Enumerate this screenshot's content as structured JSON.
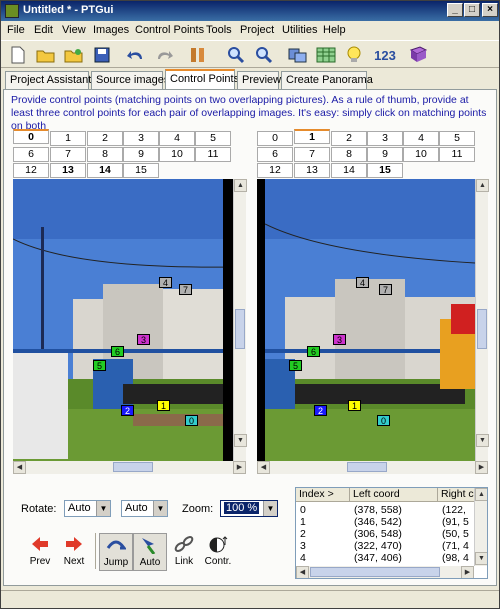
{
  "window": {
    "title": "Untitled * - PTGui"
  },
  "menu": [
    "File",
    "Edit",
    "View",
    "Images",
    "Control Points",
    "Tools",
    "Project",
    "Utilities",
    "Help"
  ],
  "toolbar": {
    "icons": [
      "new-icon",
      "open-icon",
      "open-recent-icon",
      "save-icon",
      "undo-icon",
      "redo-icon",
      "tools-icon",
      "zoom-in-icon",
      "zoom-out-icon",
      "panorama-editor-icon",
      "table-icon",
      "tips-icon",
      "numbers-icon",
      "help-book-icon"
    ],
    "numbers_label": "123"
  },
  "tabs": [
    "Project Assistant",
    "Source images",
    "Control Points",
    "Preview",
    "Create Panorama"
  ],
  "active_tab": 2,
  "instructions": "Provide control points (matching points on two overlapping pictures). As a rule of thumb, provide at least three control points for each pair of overlapping images. It's easy: simply click on matching points on both",
  "left_image_tabs": [
    "0",
    "1",
    "2",
    "3",
    "4",
    "5",
    "6",
    "7",
    "8",
    "9",
    "10",
    "11",
    "12",
    "13",
    "14",
    "15"
  ],
  "right_image_tabs": [
    "0",
    "1",
    "2",
    "3",
    "4",
    "5",
    "6",
    "7",
    "8",
    "9",
    "10",
    "11",
    "12",
    "13",
    "14",
    "15"
  ],
  "control_points_left": [
    {
      "n": "4",
      "color": "#b0b0b0"
    },
    {
      "n": "7",
      "color": "#b0b0b0"
    },
    {
      "n": "3",
      "color": "#cc33cc"
    },
    {
      "n": "6",
      "color": "#22cc22"
    },
    {
      "n": "5",
      "color": "#22cc22"
    },
    {
      "n": "2",
      "color": "#1a1aff"
    },
    {
      "n": "1",
      "color": "#ffff00"
    },
    {
      "n": "0",
      "color": "#33cccc"
    }
  ],
  "control_points_right": [
    {
      "n": "4",
      "color": "#b0b0b0"
    },
    {
      "n": "7",
      "color": "#b0b0b0"
    },
    {
      "n": "3",
      "color": "#cc33cc"
    },
    {
      "n": "6",
      "color": "#22cc22"
    },
    {
      "n": "5",
      "color": "#22cc22"
    },
    {
      "n": "2",
      "color": "#1a1aff"
    },
    {
      "n": "1",
      "color": "#ffff00"
    },
    {
      "n": "0",
      "color": "#33cccc"
    }
  ],
  "controls": {
    "rotate_label": "Rotate:",
    "rotate_left_value": "Auto",
    "rotate_right_value": "Auto",
    "zoom_label": "Zoom:",
    "zoom_value": "100 %"
  },
  "buttons": {
    "prev": "Prev",
    "next": "Next",
    "jump": "Jump",
    "auto": "Auto",
    "link": "Link",
    "contr": "Contr."
  },
  "table": {
    "columns": [
      "Index >",
      "Left coord",
      "Right c"
    ],
    "rows": [
      [
        "0",
        "(378, 558)",
        "(122,"
      ],
      [
        "1",
        "(346, 542)",
        "(91, 5"
      ],
      [
        "2",
        "(306, 548)",
        "(50, 5"
      ],
      [
        "3",
        "(322, 470)",
        "(71, 4"
      ],
      [
        "4",
        "(347, 406)",
        "(98, 4"
      ]
    ]
  }
}
